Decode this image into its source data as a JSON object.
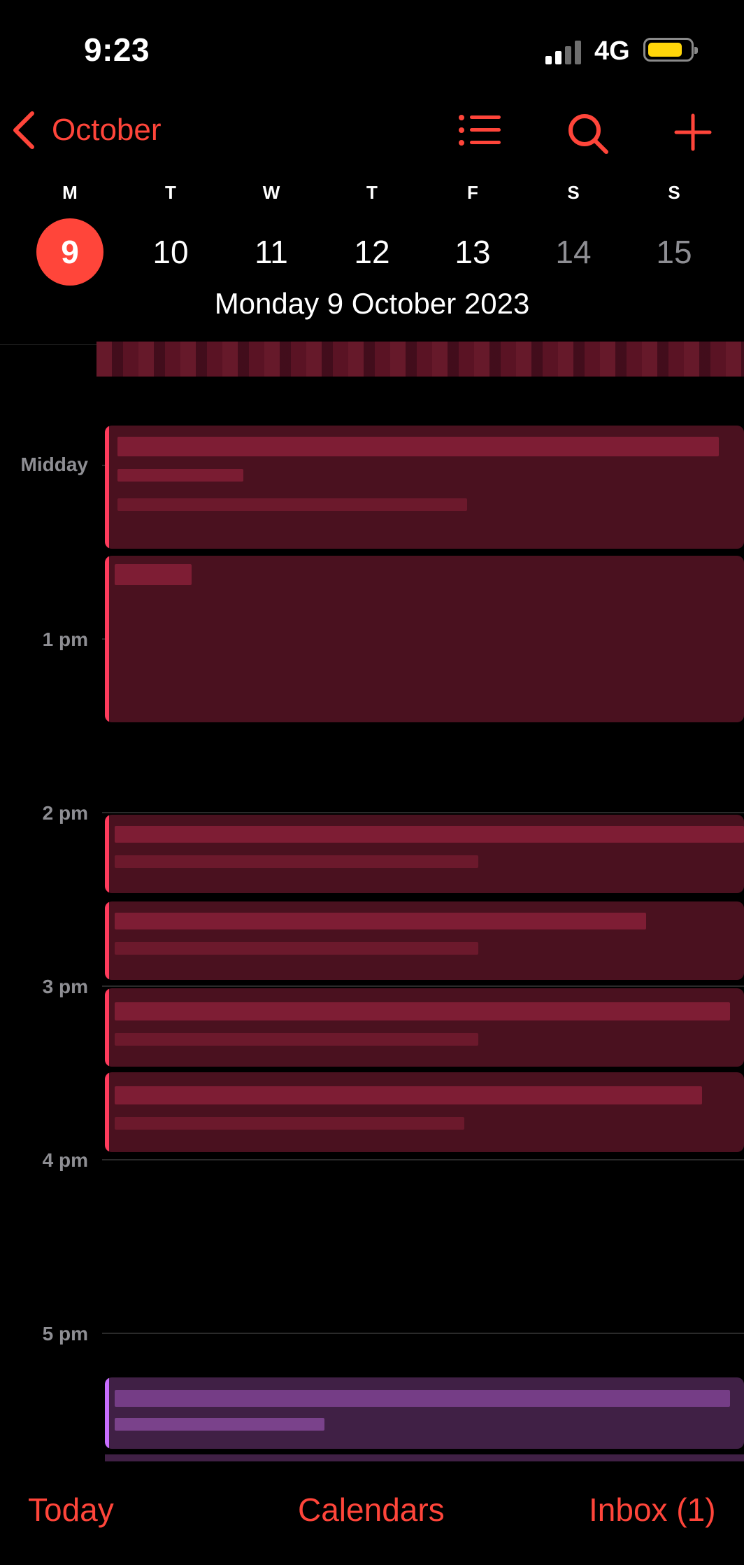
{
  "status_bar": {
    "time": "9:23",
    "network": "4G",
    "signal_icon": "cellular-signal-icon",
    "battery_icon": "battery-icon"
  },
  "nav": {
    "back_label": "October",
    "icons": [
      "list-icon",
      "search-icon",
      "add-icon"
    ]
  },
  "week": {
    "days": [
      {
        "dow": "M",
        "num": "9"
      },
      {
        "dow": "T",
        "num": "10"
      },
      {
        "dow": "W",
        "num": "11"
      },
      {
        "dow": "T",
        "num": "12"
      },
      {
        "dow": "F",
        "num": "13"
      },
      {
        "dow": "S",
        "num": "14"
      },
      {
        "dow": "S",
        "num": "15"
      }
    ],
    "selected_date": "Monday  9 October 2023"
  },
  "timeline": {
    "hours": [
      "Midday",
      "1 pm",
      "2 pm",
      "3 pm",
      "4 pm",
      "5 pm"
    ]
  },
  "colors": {
    "accent": "#ff453a",
    "event_red": "#4a111f",
    "event_bar": "#ff3b5c",
    "event_purple": "#402045",
    "event_purple_bar": "#c86dff"
  },
  "tabbar": {
    "today": "Today",
    "calendars": "Calendars",
    "inbox": "Inbox (1)"
  }
}
